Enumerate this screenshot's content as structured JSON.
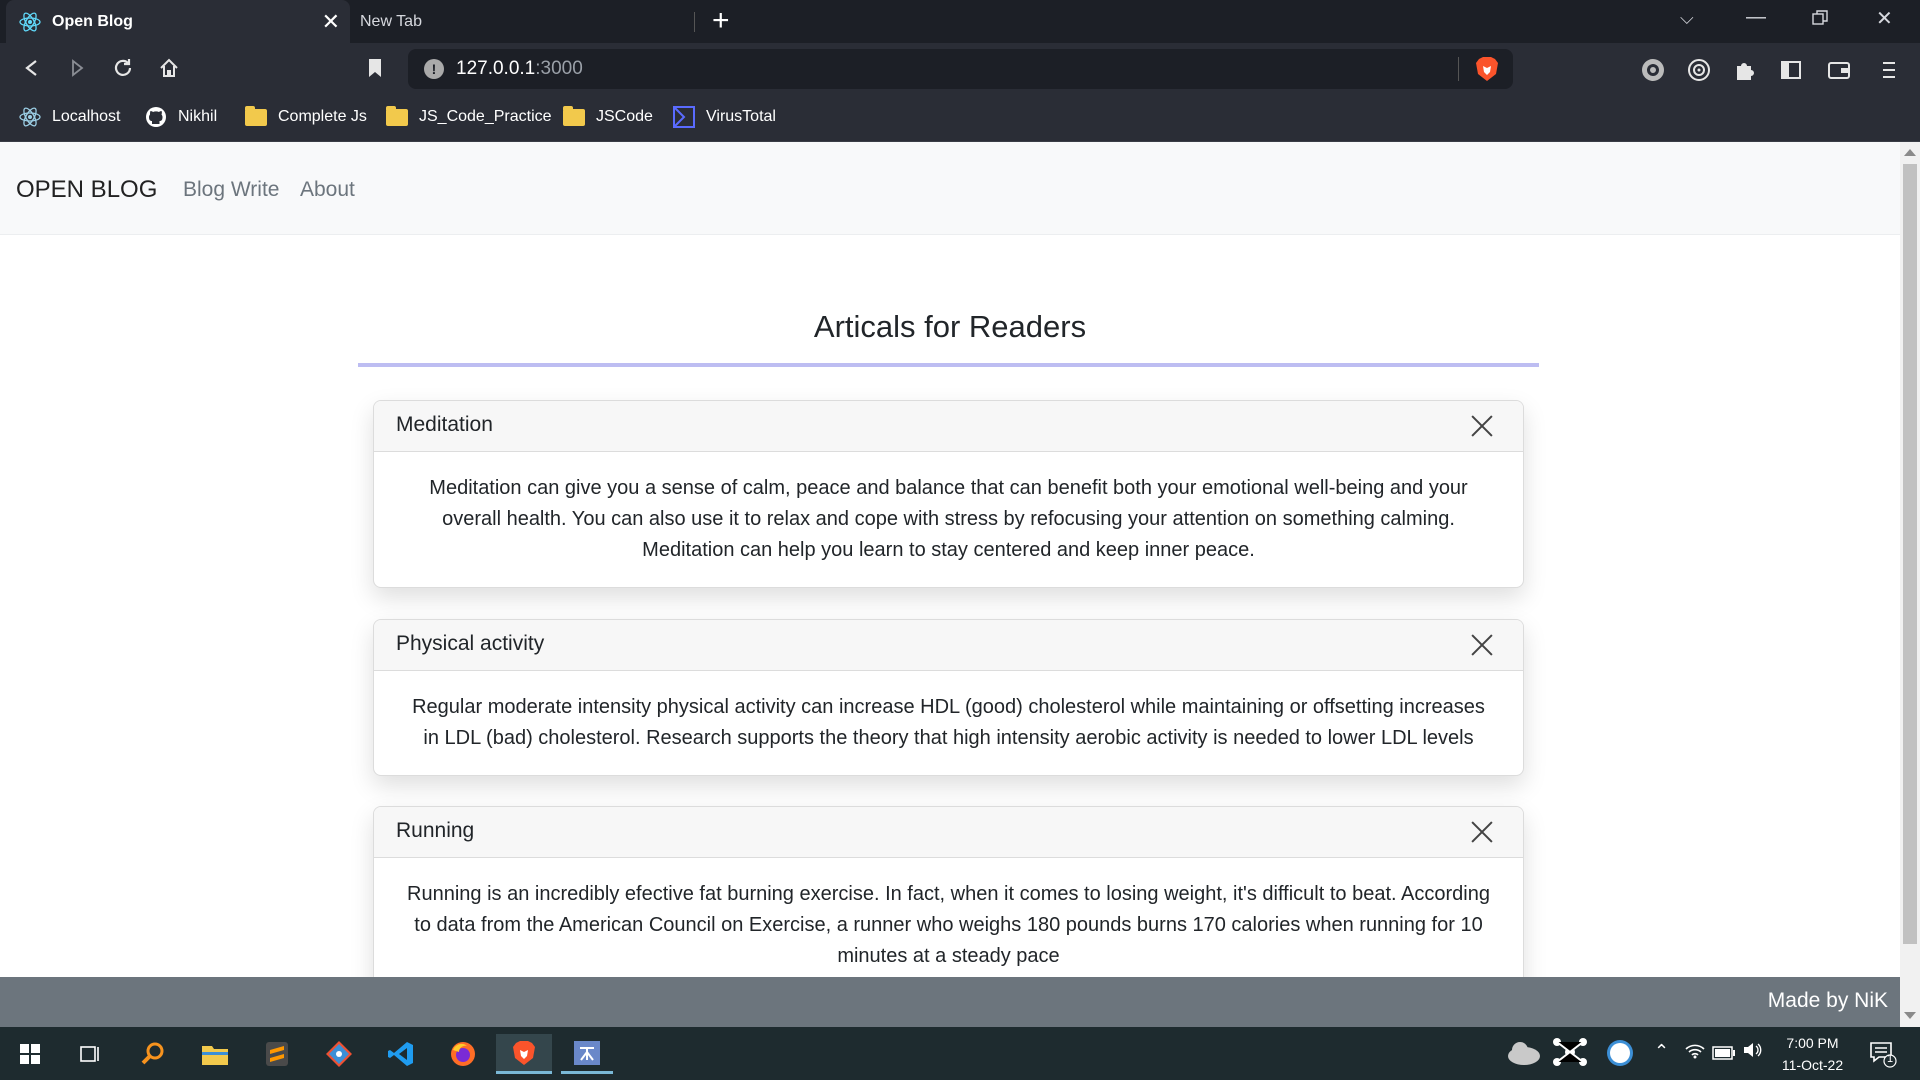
{
  "browser": {
    "tabs": [
      {
        "title": "Open Blog",
        "active": true
      },
      {
        "title": "New Tab",
        "active": false
      }
    ],
    "url_host": "127.0.0.1",
    "url_port": ":3000",
    "bookmarks": [
      {
        "label": "Localhost",
        "icon": "react-icon"
      },
      {
        "label": "Nikhil",
        "icon": "github-icon"
      },
      {
        "label": "Complete Js",
        "icon": "folder-icon"
      },
      {
        "label": "JS_Code_Practice",
        "icon": "folder-icon"
      },
      {
        "label": "JSCode",
        "icon": "folder-icon"
      },
      {
        "label": "VirusTotal",
        "icon": "virustotal-icon"
      }
    ]
  },
  "page": {
    "brand": "OPEN BLOG",
    "nav": [
      "Blog Write",
      "About"
    ],
    "heading": "Articals for Readers",
    "articles": [
      {
        "title": "Meditation",
        "body": "Meditation can give you a sense of calm, peace and balance that can benefit both your emotional well-being and your overall health. You can also use it to relax and cope with stress by refocusing your attention on something calming. Meditation can help you learn to stay centered and keep inner peace."
      },
      {
        "title": "Physical activity",
        "body": "Regular moderate intensity physical activity can increase HDL (good) cholesterol while maintaining or offsetting increases in LDL (bad) cholesterol. Research supports the theory that high intensity aerobic activity is needed to lower LDL levels"
      },
      {
        "title": "Running",
        "body": "Running is an incredibly efective fat burning exercise. In fact, when it comes to losing weight, it's difficult to beat. According to data from the American Council on Exercise, a runner who weighs 180 pounds burns 170 calories when running for 10 minutes at a steady pace"
      }
    ],
    "footer": "Made by NiK"
  },
  "taskbar": {
    "time": "7:00 PM",
    "date": "11-Oct-22",
    "notification_count": "1"
  },
  "colors": {
    "heading_rule": "#bdbdf2",
    "footer_bg": "#6c757d",
    "navbar_bg": "#f8f9fa"
  }
}
